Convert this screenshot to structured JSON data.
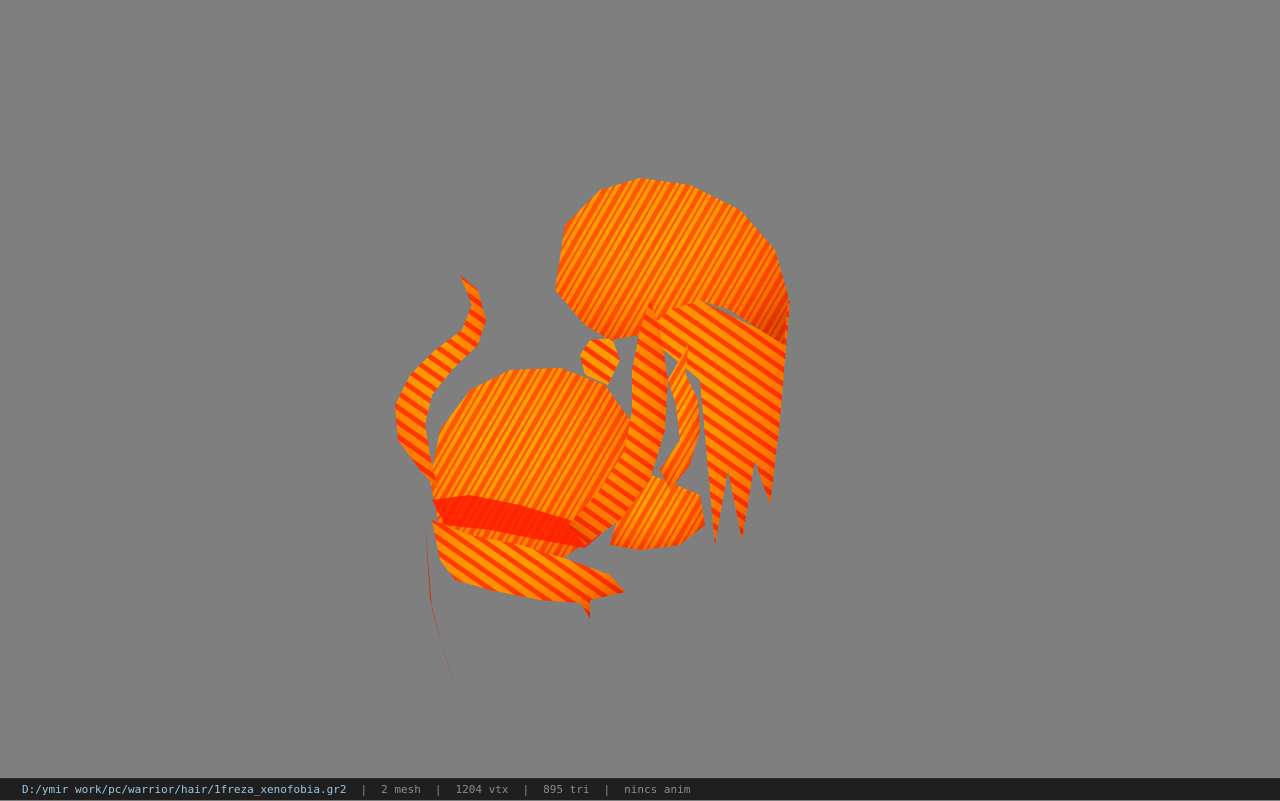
{
  "viewer": {
    "background_color": "#7f7f7f",
    "model_colors": {
      "base": "#ffa300",
      "streak": "#ff1800",
      "shadow": "#c81400"
    }
  },
  "statusbar": {
    "file_path": "D:/ymir work/pc/warrior/hair/1freza_xenofobia.gr2",
    "separator": "|",
    "mesh_count": "2 mesh",
    "vertex_count": "1204 vtx",
    "triangle_count": "895 tri",
    "anim_status": "nincs anim"
  }
}
